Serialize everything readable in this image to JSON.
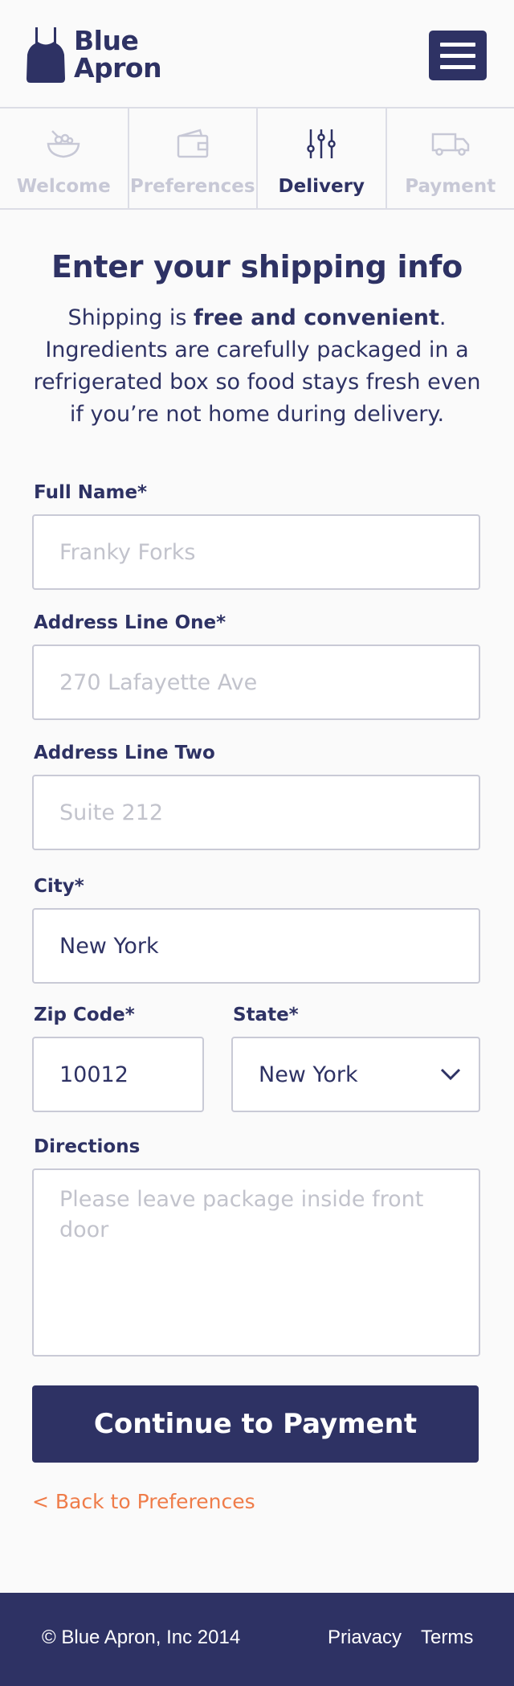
{
  "brand": {
    "line1": "Blue",
    "line2": "Apron"
  },
  "steps": [
    {
      "label": "Welcome",
      "icon": "bowl-icon",
      "active": false
    },
    {
      "label": "Preferences",
      "icon": "wallet-icon",
      "active": false
    },
    {
      "label": "Delivery",
      "icon": "sliders-icon",
      "active": true
    },
    {
      "label": "Payment",
      "icon": "truck-icon",
      "active": false
    }
  ],
  "main": {
    "title": "Enter your shipping info",
    "intro_prefix": "Shipping is ",
    "intro_bold": "free and convenient",
    "intro_suffix": ". Ingredients are carefully packaged in a refrigerated box so food stays fresh even if you’re not home during delivery."
  },
  "form": {
    "full_name": {
      "label": "Full Name*",
      "placeholder": "Franky Forks",
      "value": ""
    },
    "address_one": {
      "label": "Address Line One*",
      "placeholder": "270 Lafayette Ave",
      "value": ""
    },
    "address_two": {
      "label": "Address Line Two",
      "placeholder": "Suite 212",
      "value": ""
    },
    "city": {
      "label": "City*",
      "value": "New York"
    },
    "zip": {
      "label": "Zip Code*",
      "value": "10012"
    },
    "state": {
      "label": "State*",
      "value": "New York"
    },
    "directions": {
      "label": "Directions",
      "placeholder": "Please leave package inside front door",
      "value": ""
    },
    "submit_label": "Continue to Payment",
    "back_label": "< Back to Preferences"
  },
  "footer": {
    "copyright": "© Blue Apron, Inc 2014",
    "privacy": "Priavacy",
    "terms": "Terms"
  },
  "colors": {
    "navy": "#2e3264",
    "accent": "#ef7c49",
    "muted": "#c7c8d6"
  }
}
